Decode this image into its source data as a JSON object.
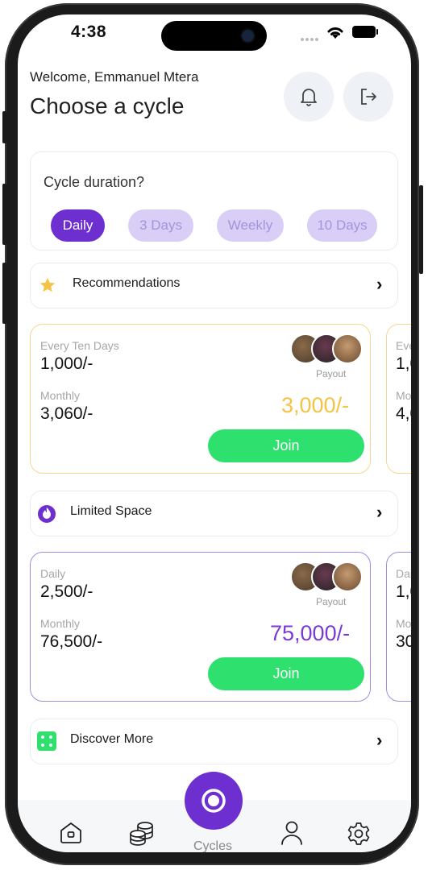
{
  "status": {
    "time": "4:38"
  },
  "header": {
    "welcome": "Welcome, Emmanuel Mtera",
    "title": "Choose a cycle"
  },
  "duration": {
    "label": "Cycle duration?",
    "options": [
      "Daily",
      "3 Days",
      "Weekly",
      "10 Days"
    ],
    "selected": "Daily"
  },
  "sections": {
    "recommendations": "Recommendations",
    "limited": "Limited Space",
    "discover": "Discover More"
  },
  "recommended_cards": [
    {
      "period_label": "Every Ten Days",
      "contribution": "1,000/-",
      "monthly_label": "Monthly",
      "monthly": "3,060/-",
      "payout_label": "Payout",
      "payout": "3,000/-",
      "join": "Join"
    },
    {
      "period_label": "Eve",
      "contribution": "1,0",
      "monthly_label": "Mo",
      "monthly": "4,0"
    }
  ],
  "limited_cards": [
    {
      "period_label": "Daily",
      "contribution": "2,500/-",
      "monthly_label": "Monthly",
      "monthly": "76,500/-",
      "payout_label": "Payout",
      "payout": "75,000/-",
      "join": "Join"
    },
    {
      "period_label": "Dai",
      "contribution": "1,0",
      "monthly_label": "Mo",
      "monthly": "30"
    }
  ],
  "tabbar": {
    "active_label": "Cycles"
  },
  "colors": {
    "purple": "#6d2fcf",
    "yellow": "#f5c344",
    "green": "#2ee06e",
    "pill_light": "#d9cef6"
  }
}
